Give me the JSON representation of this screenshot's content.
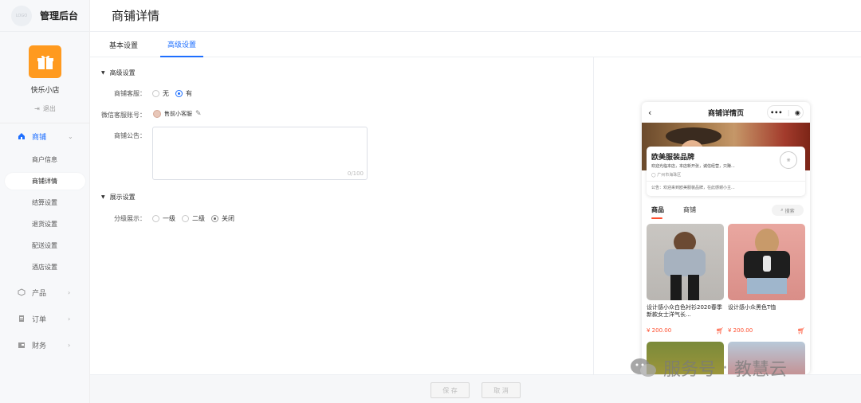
{
  "brand": {
    "logo_text": "LOGO",
    "title": "管理后台"
  },
  "shop": {
    "name": "快乐小店",
    "logout": "退出"
  },
  "menu": [
    {
      "label": "商铺",
      "icon": "home-icon",
      "active": true,
      "children": [
        "商户信息",
        "商铺详情",
        "结算设置",
        "退货设置",
        "配送设置",
        "酒店设置"
      ]
    },
    {
      "label": "产品",
      "icon": "cube-icon"
    },
    {
      "label": "订单",
      "icon": "clipboard-icon"
    },
    {
      "label": "财务",
      "icon": "wallet-icon"
    }
  ],
  "header": {
    "title": "商铺详情"
  },
  "tabs": [
    "基本设置",
    "高级设置"
  ],
  "advanced": {
    "section_title": "高级设置",
    "service_label": "商铺客服：",
    "service_options": [
      "无",
      "有"
    ],
    "service_selected": "有",
    "wechat_label": "微信客服账号：",
    "wechat_name": "售前小客服",
    "notice_label": "商铺公告：",
    "notice_counter": "0/100"
  },
  "display": {
    "section_title": "展示设置",
    "level_label": "分级展示：",
    "level_options": [
      "一级",
      "二级",
      "关闭"
    ],
    "level_selected": "关闭"
  },
  "footer": {
    "save": "保 存",
    "cancel": "取 消"
  },
  "preview": {
    "nav_title": "商铺详情页",
    "capsule_more": "•••",
    "shop_name": "欧美服装品牌",
    "shop_desc": "欢迎光临本店，本店新开张，诚信经营，只赚...",
    "shop_location": "广州市海珠区",
    "shop_notice": "公告：欢迎来到欧美服装品牌，在此感谢小主...",
    "tabs": [
      "商品",
      "商铺"
    ],
    "search": "搜索",
    "products": [
      {
        "name": "设计感小众白色衬衫2020春季新款女士洋气长...",
        "price": "¥ 200.00"
      },
      {
        "name": "设计感小众黑色T恤",
        "price": "¥ 200.00"
      }
    ]
  },
  "watermark": {
    "left": "服务号",
    "right": "教慧云"
  },
  "colors": {
    "primary": "#1e6fff",
    "accent": "#ff4d2d",
    "brand_orange": "#ff9a1f"
  }
}
